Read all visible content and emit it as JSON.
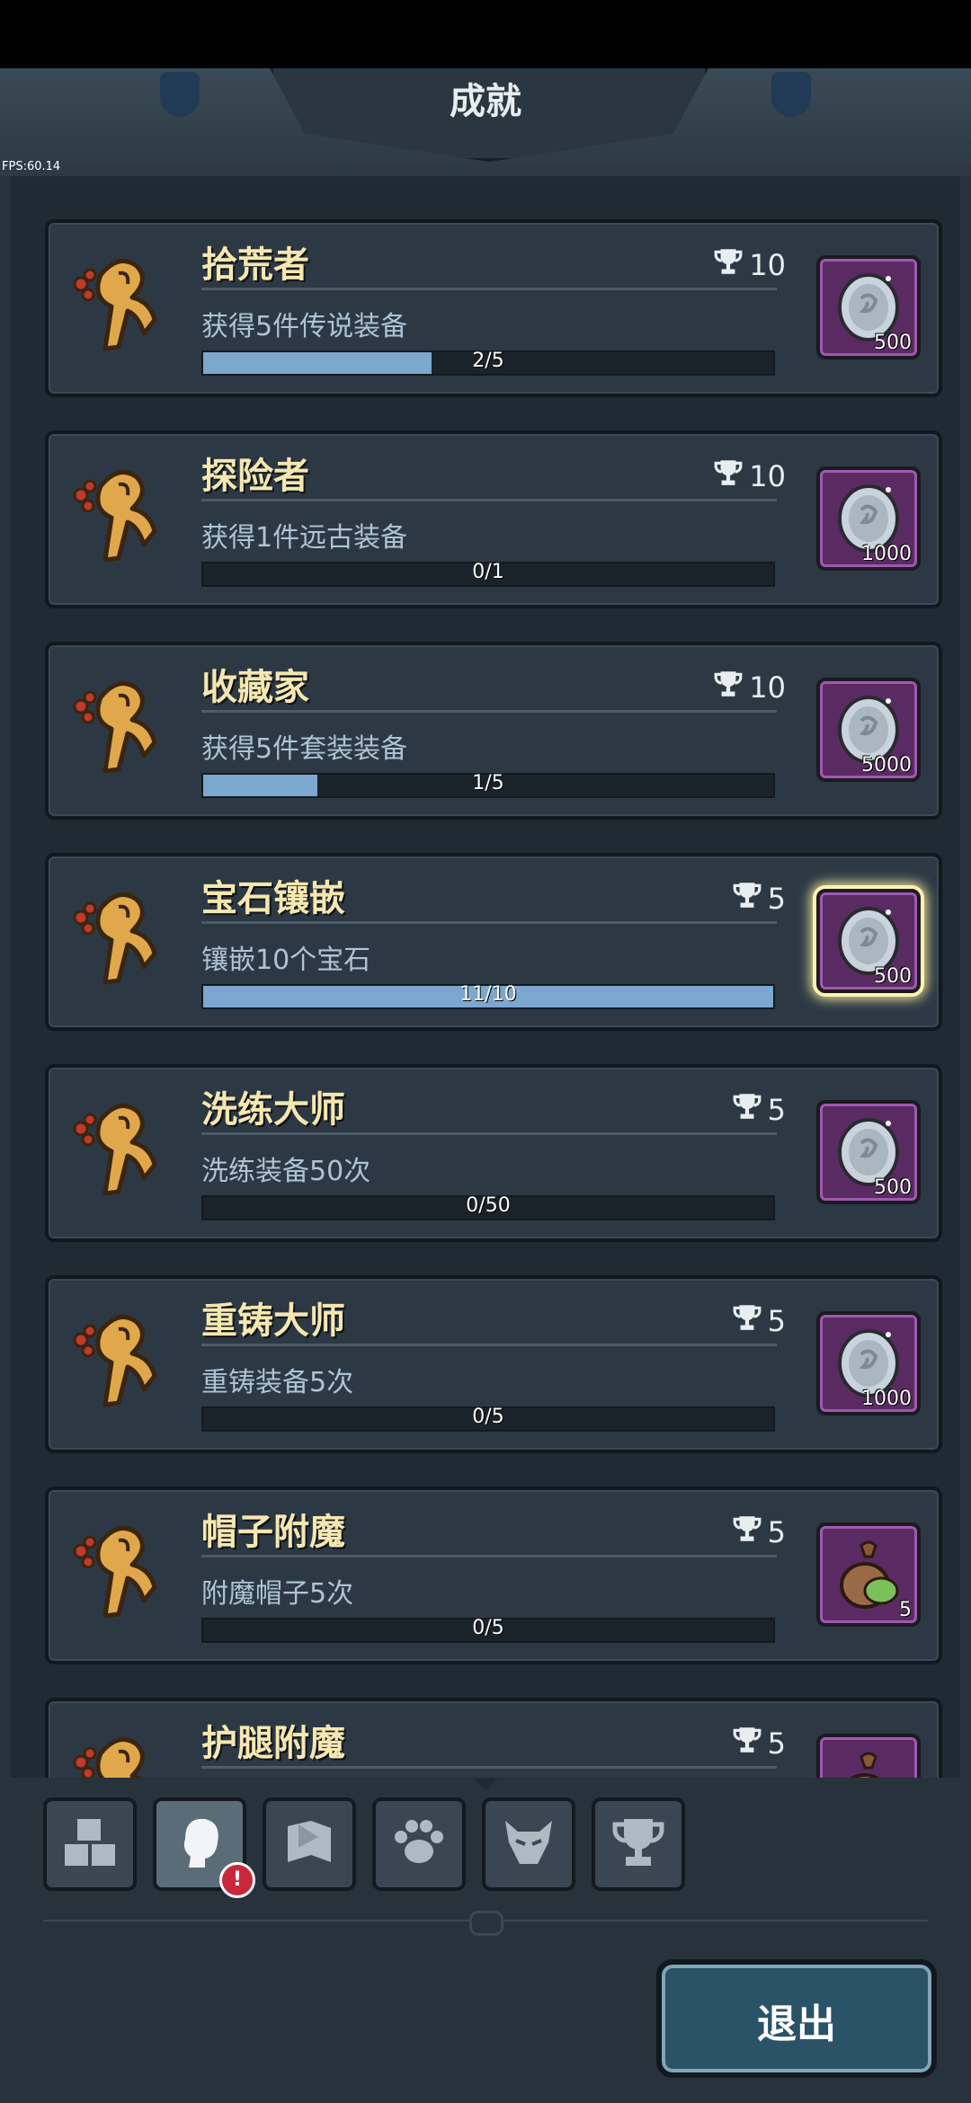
{
  "header": {
    "title": "成就",
    "fps": "FPS:60.14"
  },
  "colors": {
    "progress_fill": "#7ca7cf",
    "reward_purple": "#5a2b62",
    "title_gold": "#f4e7b0"
  },
  "achievements": [
    {
      "title": "拾荒者",
      "points": "10",
      "desc": "获得5件传说装备",
      "progress_text": "2/5",
      "progress": 0.4,
      "reward_icon": "silver-coin-icon",
      "reward_count": "500",
      "glow": false
    },
    {
      "title": "探险者",
      "points": "10",
      "desc": "获得1件远古装备",
      "progress_text": "0/1",
      "progress": 0.0,
      "reward_icon": "silver-coin-icon",
      "reward_count": "1000",
      "glow": false
    },
    {
      "title": "收藏家",
      "points": "10",
      "desc": "获得5件套装装备",
      "progress_text": "1/5",
      "progress": 0.2,
      "reward_icon": "silver-coin-icon",
      "reward_count": "5000",
      "glow": false
    },
    {
      "title": "宝石镶嵌",
      "points": "5",
      "desc": "镶嵌10个宝石",
      "progress_text": "11/10",
      "progress": 1.0,
      "reward_icon": "silver-coin-icon",
      "reward_count": "500",
      "glow": true
    },
    {
      "title": "洗练大师",
      "points": "5",
      "desc": "洗练装备50次",
      "progress_text": "0/50",
      "progress": 0.0,
      "reward_icon": "silver-coin-icon",
      "reward_count": "500",
      "glow": false
    },
    {
      "title": "重铸大师",
      "points": "5",
      "desc": "重铸装备5次",
      "progress_text": "0/5",
      "progress": 0.0,
      "reward_icon": "silver-coin-icon",
      "reward_count": "1000",
      "glow": false
    },
    {
      "title": "帽子附魔",
      "points": "5",
      "desc": "附魔帽子5次",
      "progress_text": "0/5",
      "progress": 0.0,
      "reward_icon": "seed-bag-icon",
      "reward_count": "5",
      "glow": false
    },
    {
      "title": "护腿附魔",
      "points": "5",
      "desc": "",
      "progress_text": "",
      "progress": 0.0,
      "reward_icon": "seed-bag-icon",
      "reward_count": "",
      "glow": false
    }
  ],
  "tabs": [
    {
      "icon": "blocks-icon",
      "active": false
    },
    {
      "icon": "hero-head-icon",
      "active": true,
      "badge": "!"
    },
    {
      "icon": "map-flag-icon",
      "active": false
    },
    {
      "icon": "paw-icon",
      "active": false
    },
    {
      "icon": "monster-icon",
      "active": false
    },
    {
      "icon": "trophy-icon",
      "active": false
    }
  ],
  "exit_button": {
    "label": "退出"
  }
}
